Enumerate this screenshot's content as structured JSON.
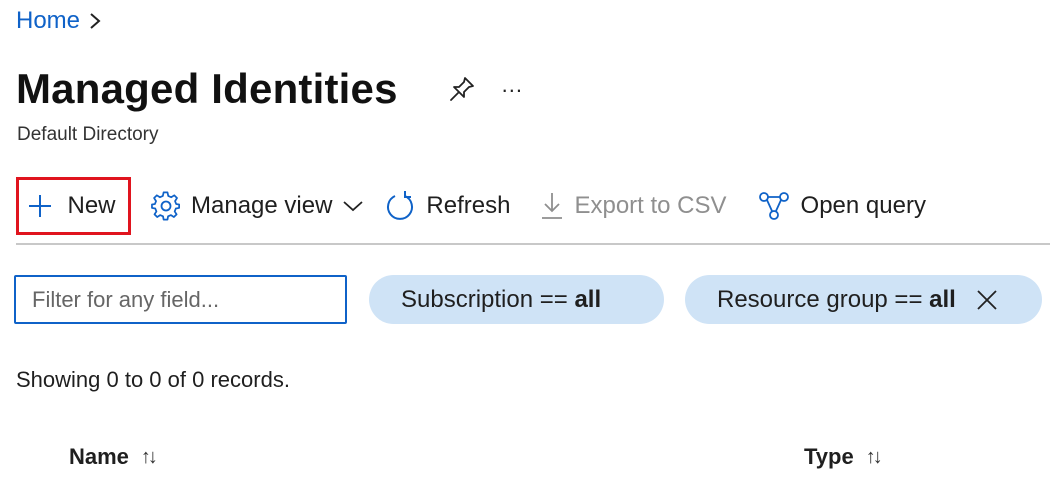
{
  "breadcrumb": {
    "home": "Home"
  },
  "header": {
    "title": "Managed Identities",
    "more": "...",
    "subtitle": "Default Directory"
  },
  "toolbar": {
    "new_label": "New",
    "manage_view_label": "Manage view",
    "refresh_label": "Refresh",
    "export_label": "Export to CSV",
    "open_query_label": "Open query"
  },
  "filters": {
    "search_placeholder": "Filter for any field...",
    "subscription": {
      "label": "Subscription == ",
      "value": "all"
    },
    "resource_group": {
      "label": "Resource group == ",
      "value": "all"
    }
  },
  "records_text": "Showing 0 to 0 of 0 records.",
  "table": {
    "columns": [
      {
        "label": "Name",
        "sort": "↑↓"
      },
      {
        "label": "Type",
        "sort": "↑↓"
      }
    ]
  },
  "colors": {
    "link": "#0f62c8",
    "highlight_border": "#e0141e",
    "pill_bg": "#cfe3f6",
    "disabled_text": "#8f8f8f"
  }
}
